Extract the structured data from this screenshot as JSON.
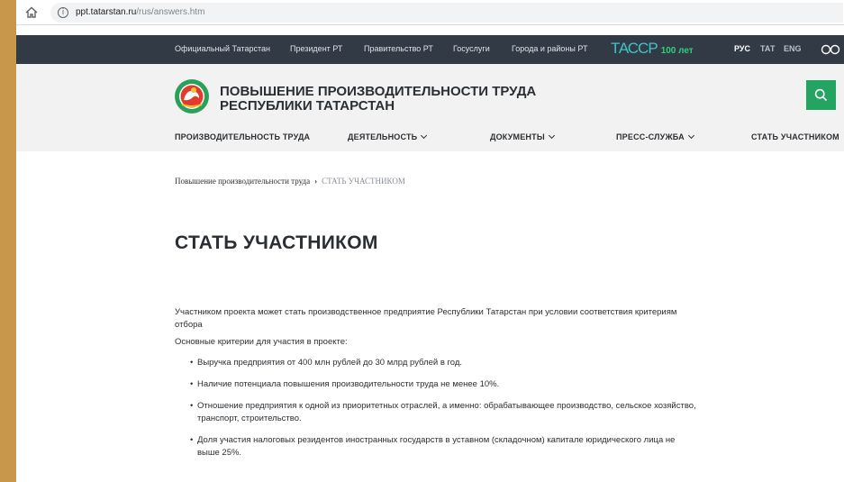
{
  "browser": {
    "url_host": "ppt.tatarstan.ru",
    "url_path": "/rus/answers.htm"
  },
  "topbar": {
    "links": [
      "Официальный Татарстан",
      "Президент РТ",
      "Правительство РТ",
      "Госуслуги",
      "Города и районы РТ"
    ],
    "tassr_logo": "ТАССР",
    "tassr_years": "100 лет",
    "languages": [
      "РУС",
      "ТАТ",
      "ENG"
    ]
  },
  "header": {
    "site_title_line1": "ПОВЫШЕНИЕ ПРОИЗВОДИТЕЛЬНОСТИ ТРУДА",
    "site_title_line2": "РЕСПУБЛИКИ ТАТАРСТАН"
  },
  "menu": [
    {
      "label": "ПРОИЗВОДИТЕЛЬНОСТЬ ТРУДА",
      "dropdown": false
    },
    {
      "label": "ДЕЯТЕЛЬНОСТЬ",
      "dropdown": true
    },
    {
      "label": "ДОКУМЕНТЫ",
      "dropdown": true
    },
    {
      "label": "ПРЕСС-СЛУЖБА",
      "dropdown": true
    },
    {
      "label": "СТАТЬ УЧАСТНИКОМ",
      "dropdown": false
    }
  ],
  "breadcrumb": {
    "home": "Повышение производительности труда",
    "separator": "›",
    "current": "СТАТЬ УЧАСТНИКОМ"
  },
  "page": {
    "title": "СТАТЬ УЧАСТНИКОМ",
    "intro": "Участником проекта может стать производственное предприятие Республики Татарстан при условии соответствия критериям отбора",
    "criteria_title": "Основные критерии для участия в проекте:",
    "criteria": [
      "Выручка предприятия от 400 млн рублей до 30 млрд рублей в год.",
      "Наличие потенциала повышения производительности труда не менее 10%.",
      "Отношение предприятия к одной из приоритетных отраслей, а именно: обрабатывающее производство, сельское хозяйство, транспорт, строительство.",
      "Доля участия налоговых резидентов иностранных государств в уставном (складочном) капитале юридического лица не выше 25%."
    ]
  },
  "colors": {
    "topbar_bg": "#323a45",
    "header_bg": "#f2f2f2",
    "accent_green": "#23a561",
    "frame": "#c9974c"
  }
}
